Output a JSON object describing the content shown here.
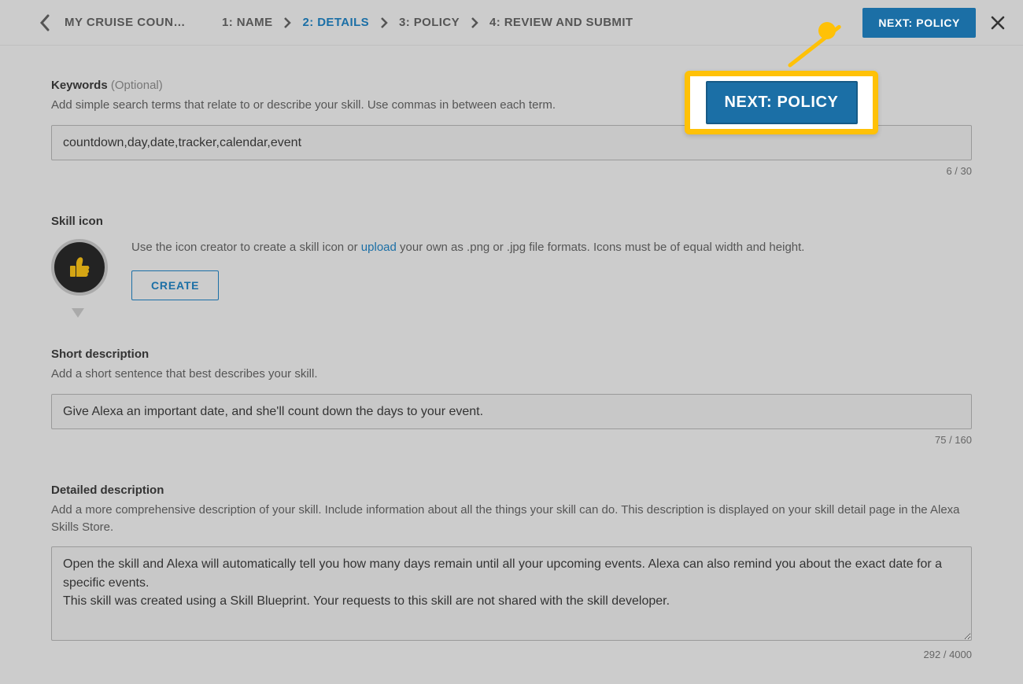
{
  "header": {
    "back_title": "MY CRUISE COUN…",
    "steps": [
      {
        "label": "1: NAME",
        "active": false
      },
      {
        "label": "2: DETAILS",
        "active": true
      },
      {
        "label": "3: POLICY",
        "active": false
      },
      {
        "label": "4: REVIEW AND SUBMIT",
        "active": false
      }
    ],
    "next_label": "NEXT: POLICY"
  },
  "callout": {
    "label": "NEXT: POLICY"
  },
  "keywords": {
    "label": "Keywords",
    "optional": "(Optional)",
    "help": "Add simple search terms that relate to or describe your skill. Use commas in between each term.",
    "value": "countdown,day,date,tracker,calendar,event",
    "counter": "6 / 30"
  },
  "skill_icon": {
    "label": "Skill icon",
    "help_pre": "Use the icon creator to create a skill icon or ",
    "upload": "upload",
    "help_post": " your own as .png or .jpg file formats. Icons must be of equal width and height.",
    "create_label": "CREATE"
  },
  "short_desc": {
    "label": "Short description",
    "help": "Add a short sentence that best describes your skill.",
    "value": "Give Alexa an important date, and she'll count down the days to your event.",
    "counter": "75 / 160"
  },
  "detailed_desc": {
    "label": "Detailed description",
    "help": "Add a more comprehensive description of your skill. Include information about all the things your skill can do. This description is displayed on your skill detail page in the Alexa Skills Store.",
    "value": "Open the skill and Alexa will automatically tell you how many days remain until all your upcoming events. Alexa can also remind you about the exact date for a specific events.\nThis skill was created using a Skill Blueprint. Your requests to this skill are not shared with the skill developer.",
    "counter": "292 / 4000"
  }
}
